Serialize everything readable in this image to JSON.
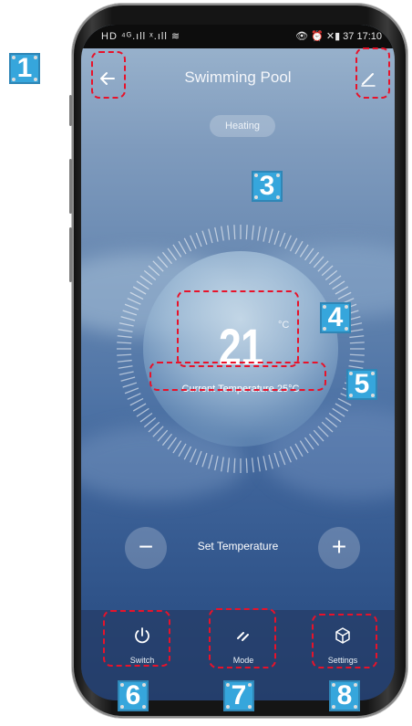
{
  "status_bar": {
    "left": "HD ⁴ᴳ.ıll ˣ.ıll ≋",
    "right": "👁 ⏰ ✕▮ 37 17:10"
  },
  "header": {
    "title": "Swimming Pool",
    "back_icon": "arrow-left-icon",
    "edit_icon": "pencil-icon"
  },
  "mode_chip": "Heating",
  "dial": {
    "value": "21",
    "unit": "°C",
    "current_temperature": "Current Temperature 25°C"
  },
  "set_temperature": {
    "label": "Set Temperature",
    "decrease": "−",
    "increase": "+"
  },
  "bottom_nav": [
    {
      "label": "Switch",
      "icon": "power-icon"
    },
    {
      "label": "Mode",
      "icon": "mode-slashes-icon"
    },
    {
      "label": "Settings",
      "icon": "cube-icon"
    }
  ],
  "markers": [
    "1",
    "3",
    "4",
    "5",
    "6",
    "7",
    "8"
  ],
  "colors": {
    "annotation_dash": "#e8122a",
    "marker_fill": "#36a6dc",
    "sky_top": "#9db6cf",
    "sky_bottom": "#274a7f"
  }
}
